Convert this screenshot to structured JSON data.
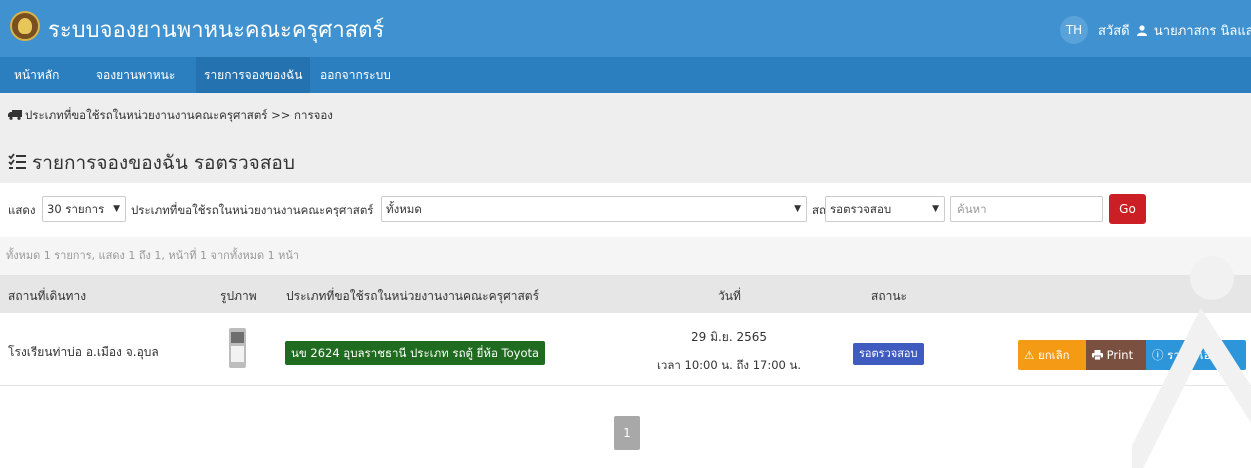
{
  "app": {
    "title": "ระบบจองยานพาหนะคณะครุศาสตร์",
    "lang": "TH",
    "greeting": "สวัสดี",
    "user_name": "นายภาสกร นิลแสง"
  },
  "nav": {
    "items": [
      {
        "label": "หน้าหลัก"
      },
      {
        "label": "จองยานพาหนะ"
      },
      {
        "label": "รายการจองของฉัน"
      },
      {
        "label": "ออกจากระบบ"
      }
    ]
  },
  "breadcrumb": {
    "text": "ประเภทที่ขอใช้รถในหน่วยงานงานคณะครุศาสตร์ >> การจอง"
  },
  "page": {
    "title": "รายการจองของฉัน รอตรวจสอบ"
  },
  "filters": {
    "show_label": "แสดง",
    "page_size": "30 รายการ",
    "type_label": "ประเภทที่ขอใช้รถในหน่วยงานงานคณะครุศาสตร์",
    "type_value": "ทั้งหมด",
    "status_label": "สถานะ",
    "status_value": "รอตรวจสอบ",
    "search_placeholder": "ค้นหา",
    "go_label": "Go"
  },
  "summary": {
    "text": "ทั้งหมด 1 รายการ, แสดง 1 ถึง 1, หน้าที่ 1 จากทั้งหมด 1 หน้า"
  },
  "table": {
    "headers": {
      "destination": "สถานที่เดินทาง",
      "image": "รูปภาพ",
      "vehicle_type": "ประเภทที่ขอใช้รถในหน่วยงานงานคณะครุศาสตร์",
      "date": "วันที่",
      "status": "สถานะ"
    },
    "rows": [
      {
        "destination": "โรงเรียนท่าบ่อ อ.เมือง จ.อุบล",
        "vehicle": "นข 2624 อุบลราชธานี ประเภท รถตู้ ยี่ห้อ Toyota",
        "date": "29 มิ.ย. 2565",
        "time": "เวลา 10:00 น. ถึง 17:00 น.",
        "status": "รอตรวจสอบ",
        "actions": {
          "cancel": "ยกเลิก",
          "print": "Print",
          "detail": "รายละเอียด"
        }
      }
    ]
  },
  "pagination": {
    "current": "1"
  },
  "colors": {
    "header": "#3f92cf",
    "nav": "#2c7fbf",
    "go": "#cc1f25",
    "vehicle_badge": "#1f6b1f",
    "status_badge": "#3f5bbf",
    "cancel": "#f49a14",
    "print": "#7a5140",
    "detail": "#2d95d9"
  }
}
